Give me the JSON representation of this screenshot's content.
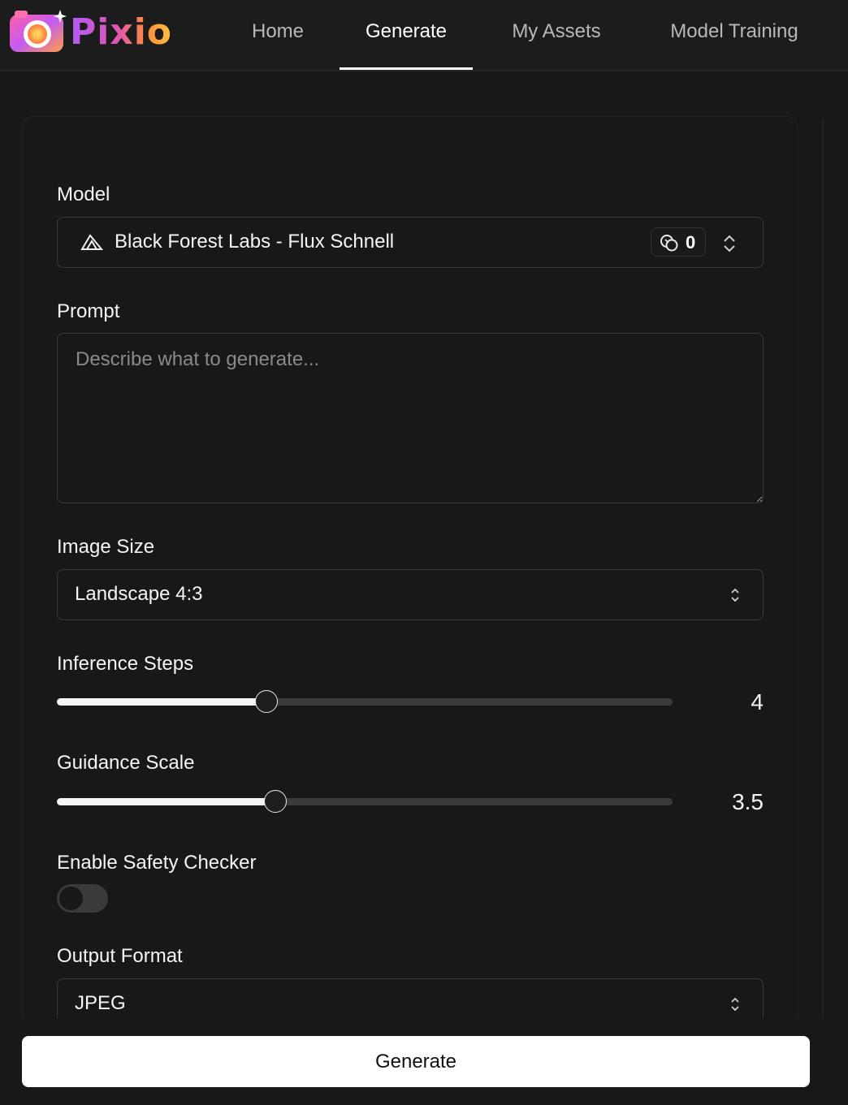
{
  "brand": {
    "name": "Pixio"
  },
  "nav": {
    "items": [
      {
        "label": "Home",
        "active": false
      },
      {
        "label": "Generate",
        "active": true
      },
      {
        "label": "My Assets",
        "active": false
      },
      {
        "label": "Model Training",
        "active": false
      }
    ]
  },
  "form": {
    "model": {
      "label": "Model",
      "value": "Black Forest Labs - Flux Schnell",
      "icon": "triangle-logo-icon",
      "credits": "0",
      "credits_icon": "coins-icon"
    },
    "prompt": {
      "label": "Prompt",
      "placeholder": "Describe what to generate...",
      "value": ""
    },
    "image_size": {
      "label": "Image Size",
      "value": "Landscape 4:3"
    },
    "inference_steps": {
      "label": "Inference Steps",
      "value": "4",
      "fraction": 0.34
    },
    "guidance_scale": {
      "label": "Guidance Scale",
      "value": "3.5",
      "fraction": 0.355
    },
    "safety_checker": {
      "label": "Enable Safety Checker",
      "enabled": false
    },
    "output_format": {
      "label": "Output Format",
      "value": "JPEG"
    }
  },
  "actions": {
    "generate_label": "Generate"
  },
  "colors": {
    "background": "#181818",
    "header": "#1c1c1c",
    "border": "#3a3a3a",
    "text": "#f5f5f5",
    "muted": "#b8b8b8",
    "button_bg": "#ffffff",
    "button_text": "#111111"
  }
}
